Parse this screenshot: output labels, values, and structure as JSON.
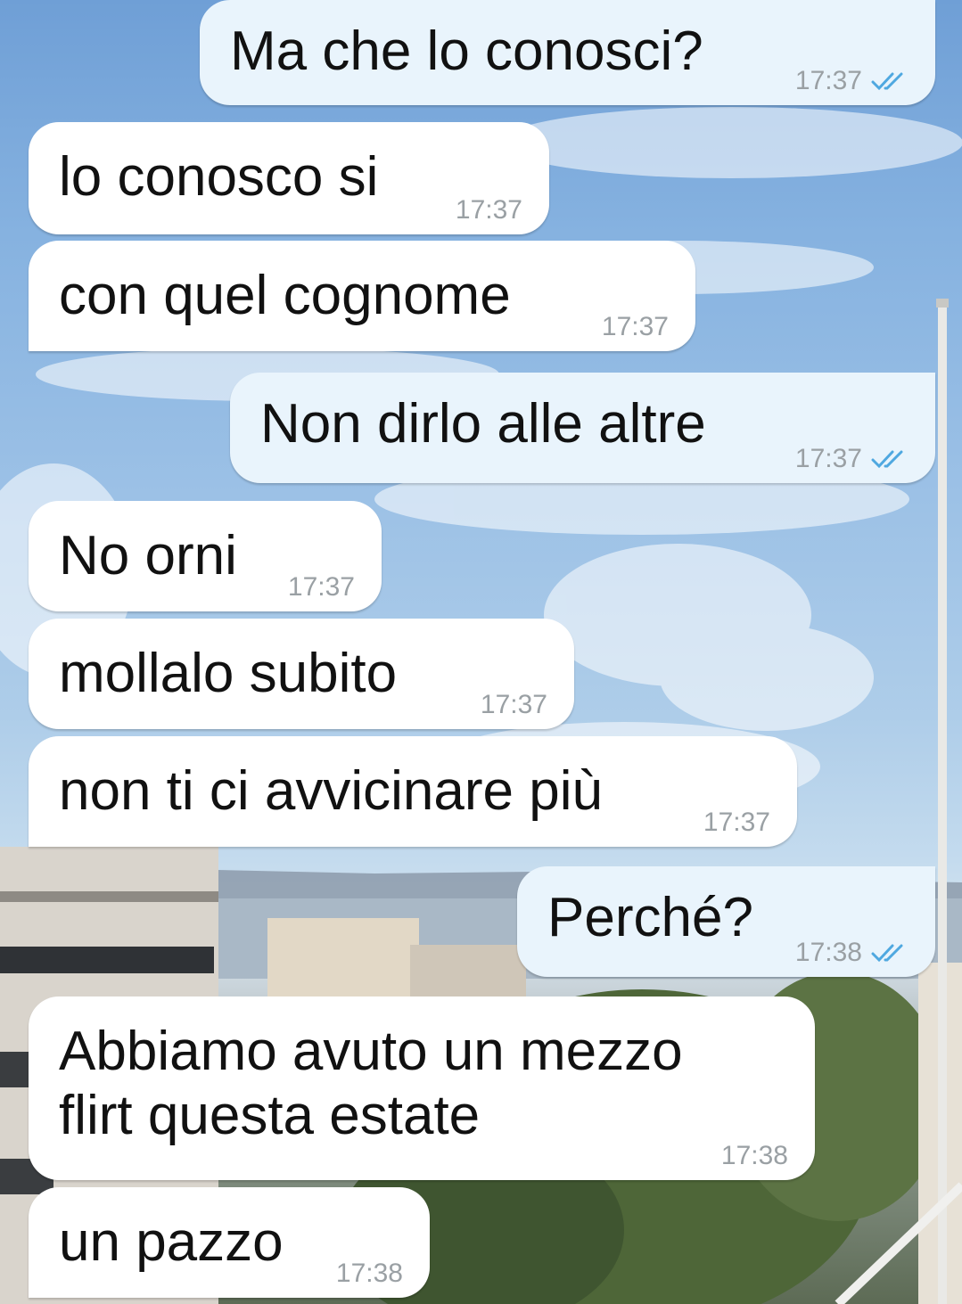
{
  "chat": {
    "messages": [
      {
        "direction": "out",
        "text": "Ma che lo conosci?",
        "time": "17:37",
        "status_icon": "double-check-icon"
      },
      {
        "direction": "in",
        "text": "lo conosco si",
        "time": "17:37"
      },
      {
        "direction": "in",
        "text": "con quel cognome",
        "time": "17:37"
      },
      {
        "direction": "out",
        "text": "Non dirlo alle altre",
        "time": "17:37",
        "status_icon": "double-check-icon"
      },
      {
        "direction": "in",
        "text": "No orni",
        "time": "17:37"
      },
      {
        "direction": "in",
        "text": "mollalo subito",
        "time": "17:37"
      },
      {
        "direction": "in",
        "text": "non ti ci avvicinare più",
        "time": "17:37"
      },
      {
        "direction": "out",
        "text": "Perché?",
        "time": "17:38",
        "status_icon": "double-check-icon"
      },
      {
        "direction": "in",
        "text": "Abbiamo avuto un mezzo\nflirt questa estate",
        "time": "17:38"
      },
      {
        "direction": "in",
        "text": "un pazzo",
        "time": "17:38"
      }
    ]
  },
  "colors": {
    "incoming_bubble": "#ffffff",
    "outgoing_bubble": "#e9f4fc",
    "timestamp": "#9aa0a4",
    "read_ticks": "#4fa8e0"
  }
}
